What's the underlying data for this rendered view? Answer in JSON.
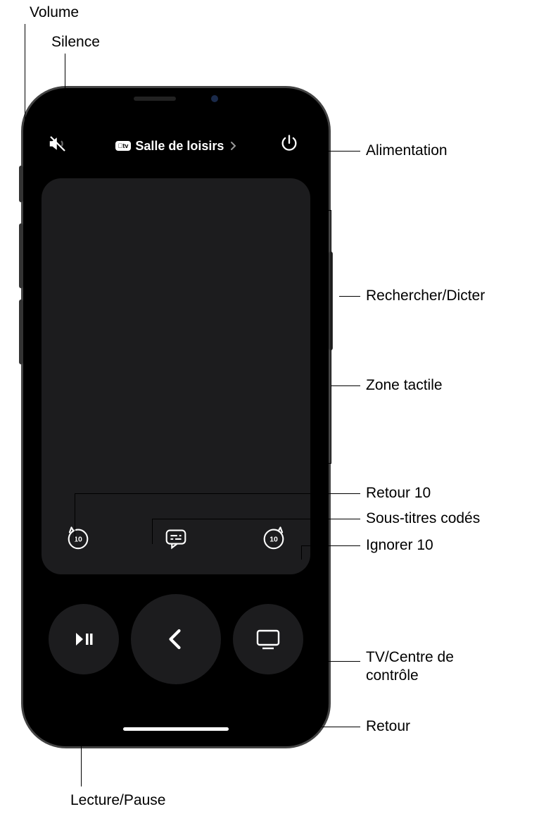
{
  "app": {
    "device_badge": "tv",
    "device_name": "Salle de loisirs"
  },
  "icons": {
    "mute": "mute-icon",
    "power": "power-icon",
    "skip_back_label": "10",
    "captions": "captions-icon",
    "skip_forward_label": "10",
    "play_pause": "play-pause-icon",
    "back_chevron": "chevron-left-icon",
    "tv_control": "tv-icon"
  },
  "callouts": {
    "volume": "Volume",
    "silence": "Silence",
    "alimentation": "Alimentation",
    "rechercher_dicter": "Rechercher/Dicter",
    "zone_tactile": "Zone tactile",
    "retour_10": "Retour 10",
    "sous_titres": "Sous-titres codés",
    "ignorer_10": "Ignorer 10",
    "tv_centre": "TV/Centre de contrôle",
    "retour": "Retour",
    "lecture_pause": "Lecture/Pause"
  }
}
